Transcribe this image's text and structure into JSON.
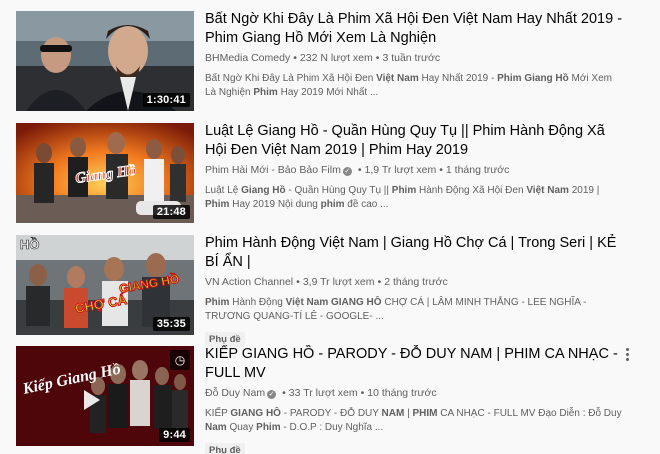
{
  "results": [
    {
      "title": "Bất Ngờ Khi Đây Là Phim Xã Hội Đen Việt Nam Hay Nhất 2019 - Phim Giang Hồ Mới Xem Là Nghiện",
      "channel": "BHMedia Comedy",
      "verified": false,
      "views": "232 N lượt xem",
      "age": "3 tuần trước",
      "duration": "1:30:41",
      "description": [
        {
          "t": "Bất Ngờ Khi Đây Là Phim Xã Hội Đen ",
          "b": false
        },
        {
          "t": "Việt Nam",
          "b": true
        },
        {
          "t": " Hay Nhất 2019 - ",
          "b": false
        },
        {
          "t": "Phim Giang Hồ",
          "b": true
        },
        {
          "t": " Mới Xem Là Nghiện ",
          "b": false
        },
        {
          "t": "Phim",
          "b": true
        },
        {
          "t": " Hay 2019 Mới Nhất ...",
          "b": false
        }
      ],
      "badge": ""
    },
    {
      "title": "Luật Lệ Giang Hồ - Quần Hùng Quy Tụ || Phim Hành Động Xã Hội Đen Việt Nam 2019 | Phim Hay 2019",
      "channel": "Phim Hài Mới - Bảo Bảo Film",
      "verified": true,
      "views": "1,9 Tr lượt xem",
      "age": "1 tháng trước",
      "duration": "21:48",
      "description": [
        {
          "t": "Luật Lệ ",
          "b": false
        },
        {
          "t": "Giang Hồ",
          "b": true
        },
        {
          "t": " - Quần Hùng Quy Tụ || ",
          "b": false
        },
        {
          "t": "Phim",
          "b": true
        },
        {
          "t": " Hành Động Xã Hội Đen ",
          "b": false
        },
        {
          "t": "Việt Nam",
          "b": true
        },
        {
          "t": " 2019 | ",
          "b": false
        },
        {
          "t": "Phim",
          "b": true
        },
        {
          "t": " Hay 2019 Nội dung ",
          "b": false
        },
        {
          "t": "phim",
          "b": true
        },
        {
          "t": " đề cao ...",
          "b": false
        }
      ],
      "badge": ""
    },
    {
      "title": "Phim Hành Động Việt Nam | Giang Hồ Chợ Cá | Trong Seri | KẺ BÍ ẨN |",
      "channel": "VN Action Channel",
      "verified": false,
      "views": "3,9 Tr lượt xem",
      "age": "2 tháng trước",
      "duration": "35:35",
      "description": [
        {
          "t": "Phim",
          "b": true
        },
        {
          "t": " Hành Động ",
          "b": false
        },
        {
          "t": "Việt Nam GIANG HỒ",
          "b": true
        },
        {
          "t": " CHỢ CÁ | LÂM MINH THẮNG - LEE NGHĨA - TRƯƠNG QUANG-TÍ LÊ - GOOGLE- ...",
          "b": false
        }
      ],
      "badge": "Phụ đề"
    },
    {
      "title": "KIẾP GIANG HỒ - PARODY - ĐỖ DUY NAM | PHIM CA NHẠC - FULL MV",
      "channel": "Đỗ Duy Nam",
      "verified": true,
      "views": "33 Tr lượt xem",
      "age": "10 tháng trước",
      "duration": "9:44",
      "description": [
        {
          "t": "KIẾP ",
          "b": false
        },
        {
          "t": "GIANG HỒ",
          "b": true
        },
        {
          "t": " - PARODY - ĐỖ DUY ",
          "b": false
        },
        {
          "t": "NAM",
          "b": true
        },
        {
          "t": " | ",
          "b": false
        },
        {
          "t": "PHIM",
          "b": true
        },
        {
          "t": " CA NHẠC - FULL MV Đạo Diễn : Đỗ Duy ",
          "b": false
        },
        {
          "t": "Nam",
          "b": true
        },
        {
          "t": " Quay ",
          "b": false
        },
        {
          "t": "Phim",
          "b": true
        },
        {
          "t": " - D.O.P : Duy Nghĩa ...",
          "b": false
        }
      ],
      "badge": "Phụ đề"
    }
  ],
  "thumbnail_text": {
    "row2": "Giang Hồ",
    "row3_top": "HỒ",
    "row3_a": "GIANG HỒ",
    "row3_b": "CHỢ CÁ",
    "row4": "Kiếp Giang Hồ"
  },
  "verified_mark": "✓",
  "watch_later_icon": "clock-icon",
  "menu_icon": "more-vert-icon"
}
